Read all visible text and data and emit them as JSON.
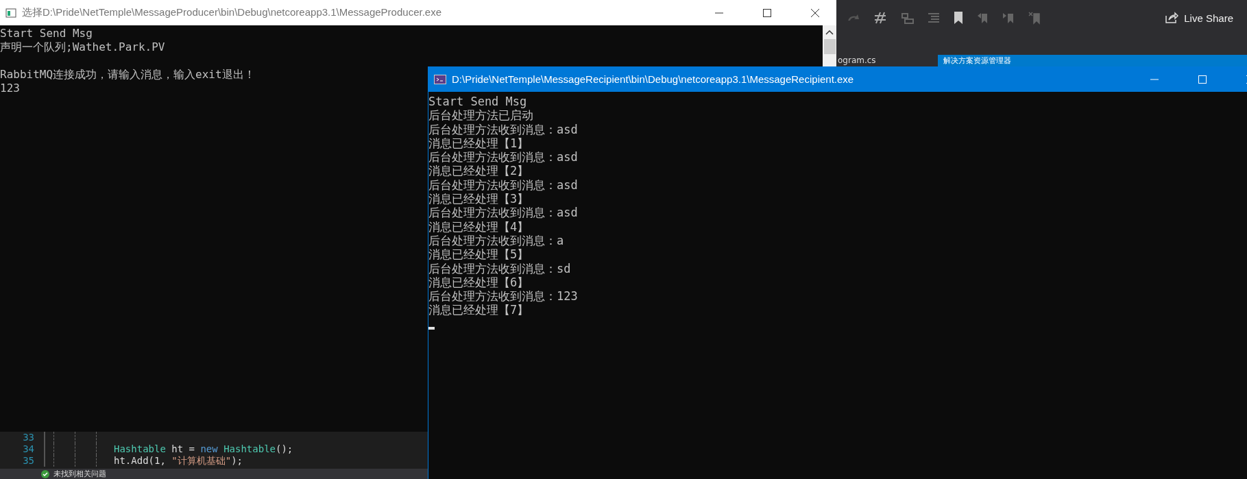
{
  "producer_window": {
    "title": "选择D:\\Pride\\NetTemple\\MessageProducer\\bin\\Debug\\netcoreapp3.1\\MessageProducer.exe",
    "console_blocks": [
      {
        "lines": [
          "Start Send Msg",
          "声明一个队列;Wathet.Park.PV"
        ]
      },
      {
        "lines": [
          "RabbitMQ连接成功，请输入消息，输入exit退出！",
          "123"
        ]
      }
    ]
  },
  "visual_studio": {
    "live_share": "Live Share",
    "tab_label": "ogram.cs",
    "panel_title": "解决方案资源管理器",
    "code_lines": [
      {
        "number": "33"
      },
      {
        "number": "34",
        "segments": [
          {
            "kind": "type",
            "text": "Hashtable"
          },
          {
            "kind": "plain",
            "text": " ht = "
          },
          {
            "kind": "keyword",
            "text": "new "
          },
          {
            "kind": "type",
            "text": "Hashtable"
          },
          {
            "kind": "plain",
            "text": "();"
          }
        ]
      },
      {
        "number": "35",
        "segments": [
          {
            "kind": "plain",
            "text": "ht.Add(1, "
          },
          {
            "kind": "string",
            "text": "\"计算机基础\""
          },
          {
            "kind": "plain",
            "text": ");"
          }
        ]
      }
    ],
    "status_text": "未找到相关问题"
  },
  "recipient_window": {
    "title": "D:\\Pride\\NetTemple\\MessageRecipient\\bin\\Debug\\netcoreapp3.1\\MessageRecipient.exe",
    "console_lines": [
      {
        "text": "Start Send Msg"
      },
      {
        "text": "后台处理方法已启动"
      },
      {
        "text": "后台处理方法收到消息：asd"
      },
      {
        "text": "消息已经处理【1】"
      },
      {
        "text": "后台处理方法收到消息：asd"
      },
      {
        "text": "消息已经处理【2】"
      },
      {
        "text": "后台处理方法收到消息：asd"
      },
      {
        "text": "消息已经处理【3】"
      },
      {
        "text": "后台处理方法收到消息：asd"
      },
      {
        "text": "消息已经处理【4】"
      },
      {
        "text": "后台处理方法收到消息：a"
      },
      {
        "text": "消息已经处理【5】"
      },
      {
        "text": "后台处理方法收到消息：sd"
      },
      {
        "text": "消息已经处理【6】"
      },
      {
        "text": "后台处理方法收到消息：123"
      },
      {
        "text": "消息已经处理【7】"
      }
    ],
    "cursor": true
  }
}
